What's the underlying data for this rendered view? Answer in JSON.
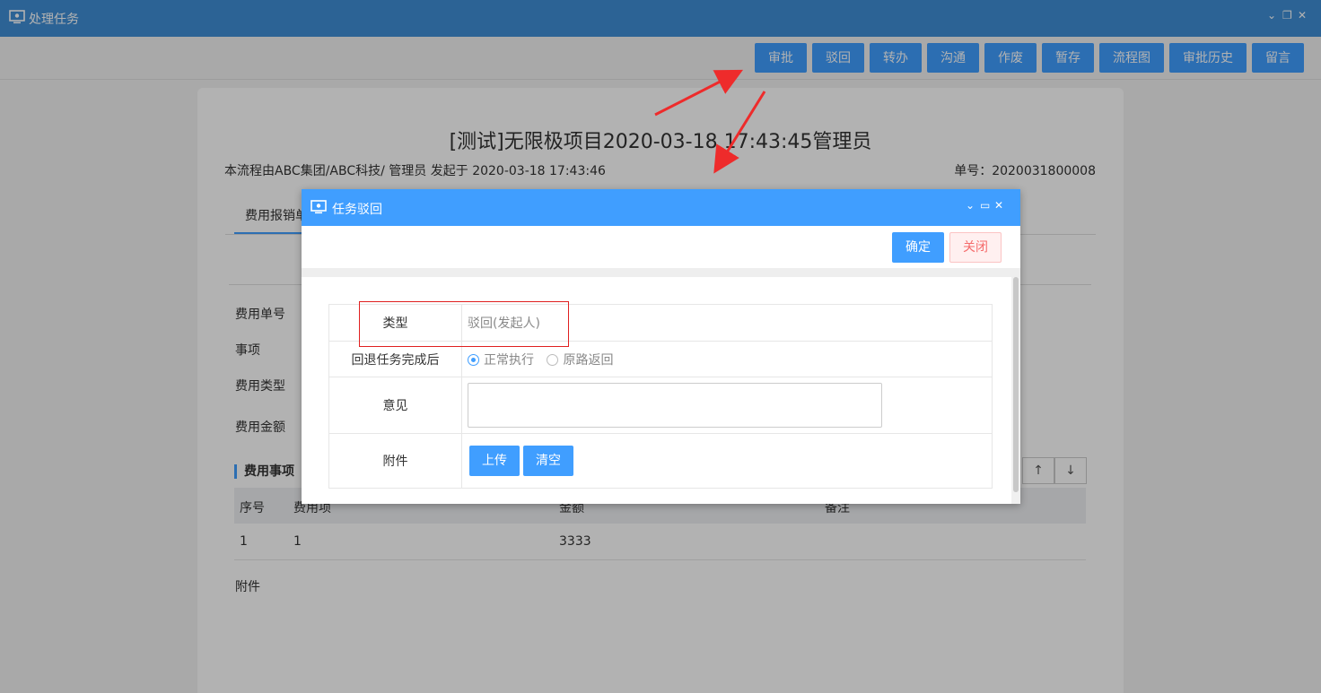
{
  "window": {
    "title": "处理任务",
    "controls": [
      "⌄",
      "❐",
      "✕"
    ]
  },
  "toolbar": {
    "buttons": [
      "审批",
      "驳回",
      "转办",
      "沟通",
      "作废",
      "暂存",
      "流程图",
      "审批历史",
      "留言"
    ]
  },
  "document": {
    "title": "[测试]无限极项目2020-03-18 17:43:45管理员",
    "meta": "本流程由ABC集团/ABC科技/  管理员 发起于 2020-03-18 17:43:46",
    "number": "单号：2020031800008",
    "tab": "费用报销单",
    "fields": [
      "费用单号",
      "事项",
      "费用类型",
      "费用金额"
    ],
    "section": "费用事项",
    "arrows": [
      "↑",
      "↓"
    ],
    "grid": {
      "headers": [
        "序号",
        "费用项",
        "金额",
        "备注"
      ],
      "rows": [
        [
          "1",
          "1",
          "3333",
          ""
        ]
      ]
    },
    "attachment_label": "附件"
  },
  "dialog": {
    "title": "任务驳回",
    "controls": [
      "⌄",
      "▭",
      "✕"
    ],
    "ok": "确定",
    "close": "关闭",
    "form": {
      "type_label": "类型",
      "type_value": "驳回(发起人)",
      "after_label": "回退任务完成后",
      "option_normal": "正常执行",
      "option_return": "原路返回",
      "opinion_label": "意见",
      "attach_label": "附件",
      "upload": "上传",
      "clear": "清空"
    }
  },
  "colors": {
    "accent": "#409eff",
    "title_bar": "#3f8fd6",
    "annotation": "#e02020"
  }
}
